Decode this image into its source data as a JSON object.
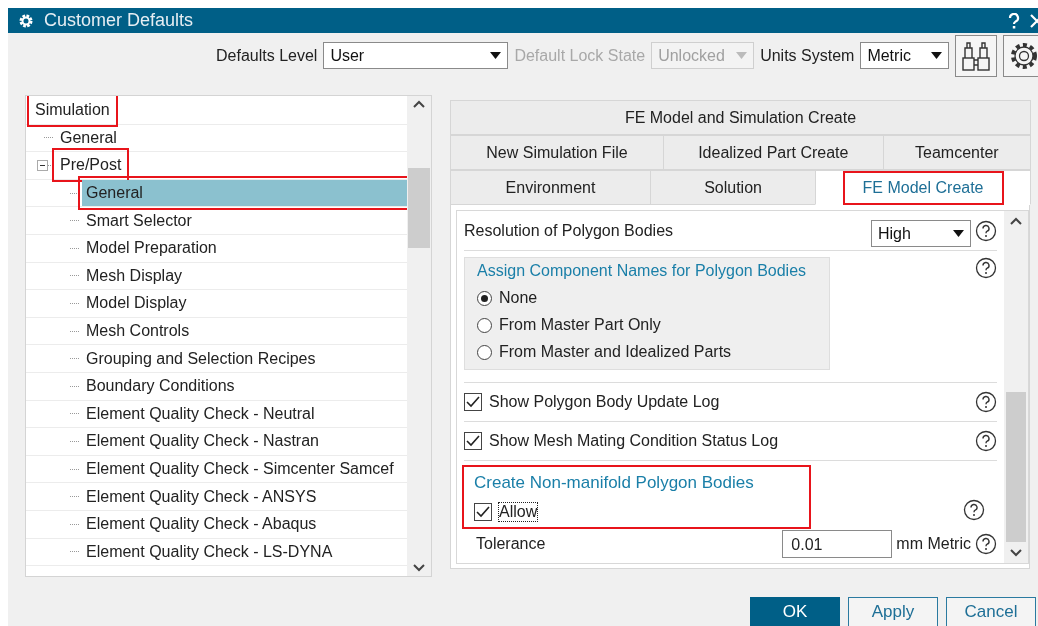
{
  "window": {
    "title": "Customer Defaults"
  },
  "toolbar": {
    "fields": [
      {
        "label": "Defaults Level",
        "value": "User",
        "disabled": false
      },
      {
        "label": "Default Lock State",
        "value": "Unlocked",
        "disabled": true
      },
      {
        "label": "Units System",
        "value": "Metric",
        "disabled": false
      }
    ]
  },
  "tree": {
    "items": [
      {
        "label": "Simulation",
        "selected": false,
        "highlighted": true,
        "children": [
          {
            "label": "General",
            "selected": false,
            "highlighted": false
          },
          {
            "label": "Pre/Post",
            "selected": false,
            "highlighted": true,
            "expanded": true,
            "children": [
              {
                "label": "General",
                "selected": true,
                "highlighted": true
              },
              {
                "label": "Smart Selector",
                "selected": false,
                "highlighted": false
              },
              {
                "label": "Model Preparation",
                "selected": false,
                "highlighted": false
              },
              {
                "label": "Mesh Display",
                "selected": false,
                "highlighted": false
              },
              {
                "label": "Model Display",
                "selected": false,
                "highlighted": false
              },
              {
                "label": "Mesh Controls",
                "selected": false,
                "highlighted": false
              },
              {
                "label": "Grouping and Selection Recipes",
                "selected": false,
                "highlighted": false
              },
              {
                "label": "Boundary Conditions",
                "selected": false,
                "highlighted": false
              },
              {
                "label": "Element Quality Check - Neutral",
                "selected": false,
                "highlighted": false
              },
              {
                "label": "Element Quality Check - Nastran",
                "selected": false,
                "highlighted": false
              },
              {
                "label": "Element Quality Check - Simcenter Samcef",
                "selected": false,
                "highlighted": false
              },
              {
                "label": "Element Quality Check - ANSYS",
                "selected": false,
                "highlighted": false
              },
              {
                "label": "Element Quality Check - Abaqus",
                "selected": false,
                "highlighted": false
              },
              {
                "label": "Element Quality Check - LS-DYNA",
                "selected": false,
                "highlighted": false
              }
            ]
          }
        ]
      }
    ]
  },
  "tab_rows": [
    {
      "tabs": [
        {
          "label": "FE Model and Simulation Create",
          "selected": false,
          "highlighted": false
        }
      ]
    },
    {
      "tabs": [
        {
          "label": "New Simulation File",
          "selected": false,
          "highlighted": false
        },
        {
          "label": "Idealized Part Create",
          "selected": false,
          "highlighted": false
        },
        {
          "label": "Teamcenter",
          "selected": false,
          "highlighted": false
        }
      ]
    },
    {
      "tabs": [
        {
          "label": "Environment",
          "selected": false,
          "highlighted": false
        },
        {
          "label": "Solution",
          "selected": false,
          "highlighted": false
        },
        {
          "label": "FE Model Create",
          "selected": true,
          "highlighted": true
        }
      ]
    }
  ],
  "settings": [
    {
      "kind": "dropdown",
      "label": "Resolution of Polygon Bodies",
      "value": "High"
    },
    {
      "kind": "radio_group",
      "title": "Assign Component Names for Polygon Bodies",
      "options": [
        {
          "label": "None",
          "selected": true
        },
        {
          "label": "From Master Part Only",
          "selected": false
        },
        {
          "label": "From Master and Idealized Parts",
          "selected": false
        }
      ]
    },
    {
      "kind": "checkbox",
      "label": "Show Polygon Body Update Log",
      "checked": true
    },
    {
      "kind": "checkbox",
      "label": "Show Mesh Mating Condition Status Log",
      "checked": true
    },
    {
      "kind": "group",
      "title": "Create Non-manifold Polygon Bodies",
      "highlighted": true,
      "option": {
        "label": "Allow",
        "checked": true,
        "focused": true
      }
    },
    {
      "kind": "field",
      "label": "Tolerance",
      "value": "0.01",
      "unit": "mm Metric"
    }
  ],
  "buttons": [
    {
      "label": "OK",
      "default": true
    },
    {
      "label": "Apply",
      "default": false
    },
    {
      "label": "Cancel",
      "default": false
    }
  ]
}
